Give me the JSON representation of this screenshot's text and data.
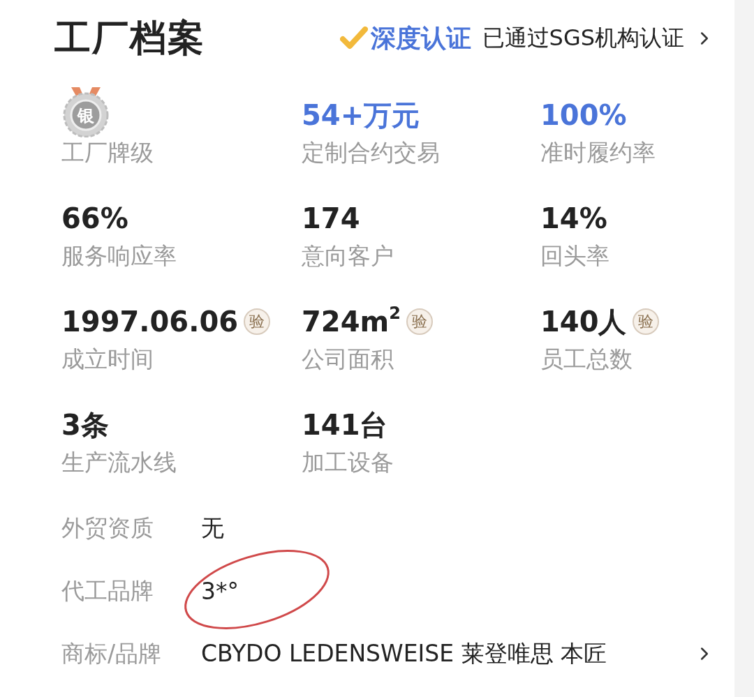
{
  "header": {
    "title": "工厂档案",
    "certification_logo": "深度认证",
    "certification_text": "已通过SGS机构认证"
  },
  "metrics": [
    {
      "kind": "medal",
      "medal_text": "银",
      "label": "工厂牌级"
    },
    {
      "kind": "value",
      "value": "54+万元",
      "accent": true,
      "label": "定制合约交易"
    },
    {
      "kind": "value",
      "value": "100%",
      "accent": true,
      "label": "准时履约率"
    },
    {
      "kind": "value",
      "value": "66%",
      "accent": false,
      "label": "服务响应率"
    },
    {
      "kind": "value",
      "value": "174",
      "accent": false,
      "label": "意向客户"
    },
    {
      "kind": "value",
      "value": "14%",
      "accent": false,
      "label": "回头率"
    },
    {
      "kind": "value",
      "value": "1997.06.06",
      "accent": false,
      "badge": "验",
      "label": "成立时间"
    },
    {
      "kind": "value",
      "value": "724m$^{2}$",
      "accent": false,
      "badge": "验",
      "label": "公司面积"
    },
    {
      "kind": "value",
      "value": "140人",
      "accent": false,
      "badge": "验",
      "label": "员工总数"
    },
    {
      "kind": "value",
      "value": "3条",
      "accent": false,
      "label": "生产流水线"
    },
    {
      "kind": "value",
      "value": "141台",
      "accent": false,
      "label": "加工设备"
    }
  ],
  "info_rows": [
    {
      "label": "外贸资质",
      "value": "无",
      "link": false,
      "circled": false
    },
    {
      "label": "代工品牌",
      "value": "3*°",
      "link": false,
      "circled": true
    },
    {
      "label": "商标/品牌",
      "value": "CBYDO LEDENSWEISE 莱登唯思 本匠",
      "link": true,
      "circled": false
    }
  ]
}
